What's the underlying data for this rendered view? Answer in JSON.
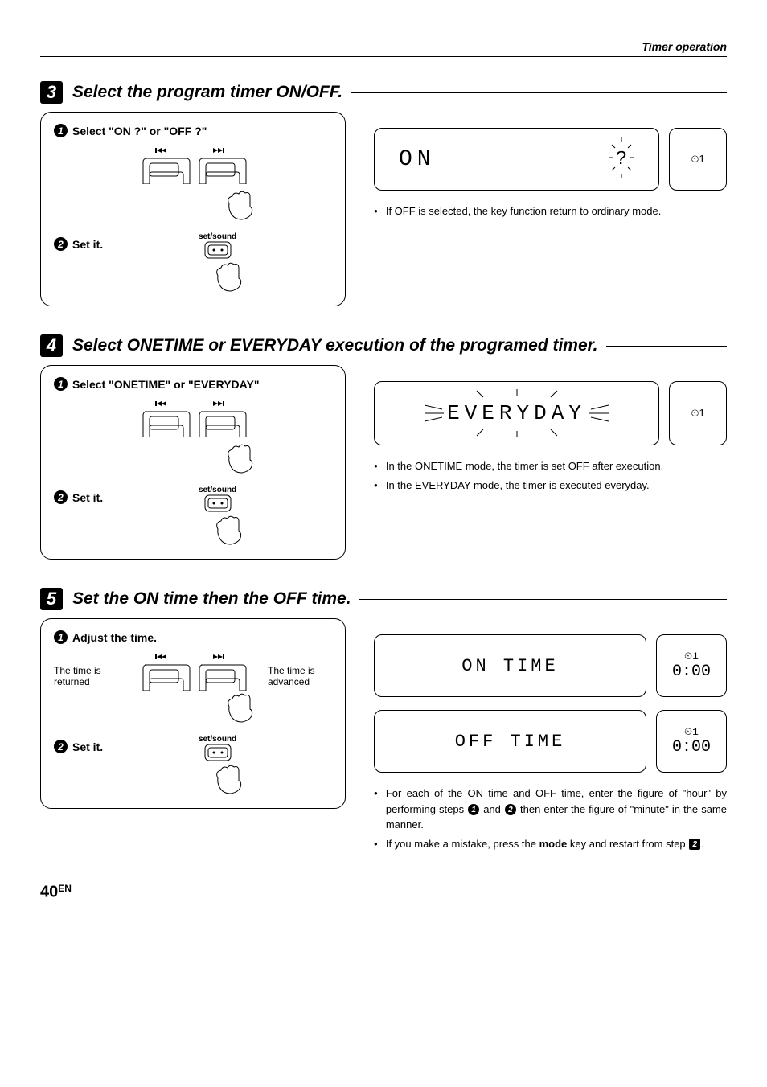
{
  "header": {
    "section": "Timer operation"
  },
  "steps": {
    "3": {
      "num": "3",
      "title": "Select the program  timer ON/OFF.",
      "sub1": {
        "n": "1",
        "label": "Select \"ON ?\" or \"OFF ?\""
      },
      "sub2": {
        "n": "2",
        "label": "Set it.",
        "btn": "set/sound"
      },
      "display": {
        "text": "ON",
        "q": "?",
        "icon": "⏲1"
      },
      "notes": [
        "If OFF is selected, the key function return to ordinary mode."
      ]
    },
    "4": {
      "num": "4",
      "title": "Select ONETIME or EVERYDAY execution of the programed timer.",
      "sub1": {
        "n": "1",
        "label": "Select \"ONETIME\" or \"EVERYDAY\""
      },
      "sub2": {
        "n": "2",
        "label": "Set it.",
        "btn": "set/sound"
      },
      "display": {
        "text": "EVERYDAY",
        "icon": "⏲1"
      },
      "notes": [
        "In the ONETIME mode, the timer is set OFF after execution.",
        "In the EVERYDAY mode, the timer is executed everyday."
      ]
    },
    "5": {
      "num": "5",
      "title": "Set the ON time then the OFF time.",
      "sub1": {
        "n": "1",
        "label": "Adjust the time.",
        "left": "The time is returned",
        "right": "The time is advanced"
      },
      "sub2": {
        "n": "2",
        "label": "Set it.",
        "btn": "set/sound"
      },
      "display1": {
        "text": "ON  TIME",
        "time": "0:00",
        "icon": "⏲1"
      },
      "display2": {
        "text": "OFF TIME",
        "time": "0:00",
        "icon": "⏲1"
      },
      "notes_pre": "For each of the ON time and OFF time, enter the figure of \"hour\" by performing steps ",
      "notes_mid": " and ",
      "notes_post": " then enter the figure of \"minute\" in the same manner.",
      "note2_pre": "If you make a mistake, press the ",
      "note2_bold": "mode",
      "note2_mid": " key and restart from step ",
      "note2_step": "2",
      "note2_post": "."
    }
  },
  "footer": {
    "page": "40",
    "lang": "EN"
  }
}
